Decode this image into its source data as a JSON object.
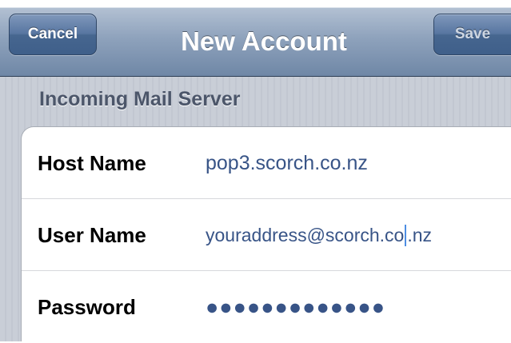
{
  "navbar": {
    "title": "New Account",
    "cancel_label": "Cancel",
    "save_label": "Save"
  },
  "section": {
    "header": "Incoming Mail Server"
  },
  "fields": [
    {
      "label": "Host Name",
      "value": "pop3.scorch.co.nz"
    },
    {
      "label": "User Name",
      "value_before_caret": "youraddress@scorch.co",
      "value_after_caret": ".nz"
    },
    {
      "label": "Password",
      "value": "●●●●●●●●●●●●●"
    }
  ],
  "colors": {
    "navbar_accent": "#6f87a6",
    "value_text": "#385487",
    "section_text": "#4c566a",
    "caret": "#4d8de3"
  }
}
